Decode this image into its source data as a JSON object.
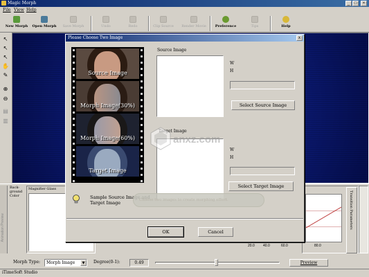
{
  "window": {
    "title": "Magic Morph"
  },
  "menu": [
    "File",
    "View",
    "Help"
  ],
  "toolbar": [
    {
      "label": "New Morph",
      "icon": "new-morph-icon",
      "enabled": true
    },
    {
      "label": "Open Morph",
      "icon": "open-morph-icon",
      "enabled": true
    },
    {
      "label": "Save Morph",
      "icon": "save-morph-icon",
      "enabled": false
    },
    {
      "label": "Undo",
      "icon": "undo-icon",
      "enabled": false
    },
    {
      "label": "Redo",
      "icon": "redo-icon",
      "enabled": false
    },
    {
      "label": "Clip Source",
      "icon": "clip-source-icon",
      "enabled": false
    },
    {
      "label": "Render Movie",
      "icon": "render-movie-icon",
      "enabled": false
    },
    {
      "label": "Preference",
      "icon": "preference-icon",
      "enabled": true
    },
    {
      "label": "Tips",
      "icon": "tips-icon",
      "enabled": false
    },
    {
      "label": "Help",
      "icon": "help-icon",
      "enabled": true
    }
  ],
  "bottom_panel": {
    "background_color_label": "Back-ground Color",
    "magnifier_title": "Magnifier Glass",
    "side_tab_label": "Animation Preview",
    "graph_tab_label": "Transition Parameters",
    "graph_ticks": [
      "20.0",
      "40.0",
      "60.0",
      "80.0"
    ]
  },
  "controls": {
    "morph_type_label": "Morph Type:",
    "morph_type_value": "Morph Image",
    "degree_label": "Degree(0-1):",
    "degree_value": "0.49",
    "preview_label": "Preview",
    "slider_fraction": 0.49
  },
  "status": "iTimeSoft Studio",
  "dialog": {
    "title": "Please Choose Two Image",
    "close_label": "x",
    "film_captions": [
      "Source Image",
      "Morph Image(30%)",
      "Morph Image(60%)",
      "Target Image"
    ],
    "source_group_label": "Source Image",
    "target_group_label": "Target Image",
    "w_label": "W",
    "h_label": "H",
    "select_source_label": "Select Source Image",
    "select_target_label": "Select Target Image",
    "hint_text": "Sample Source Image and Target Image",
    "hint_tip": "Choose two images to create morphing effect.",
    "ok_label": "OK",
    "cancel_label": "Cancel"
  },
  "watermark": {
    "text": "anxz.com"
  },
  "colors": {
    "titlebar": "#0a246a",
    "canvas": "#0c1c7a",
    "face": "#c8a08a",
    "hair": "#3a2418",
    "metal": "#8fa0b8"
  }
}
